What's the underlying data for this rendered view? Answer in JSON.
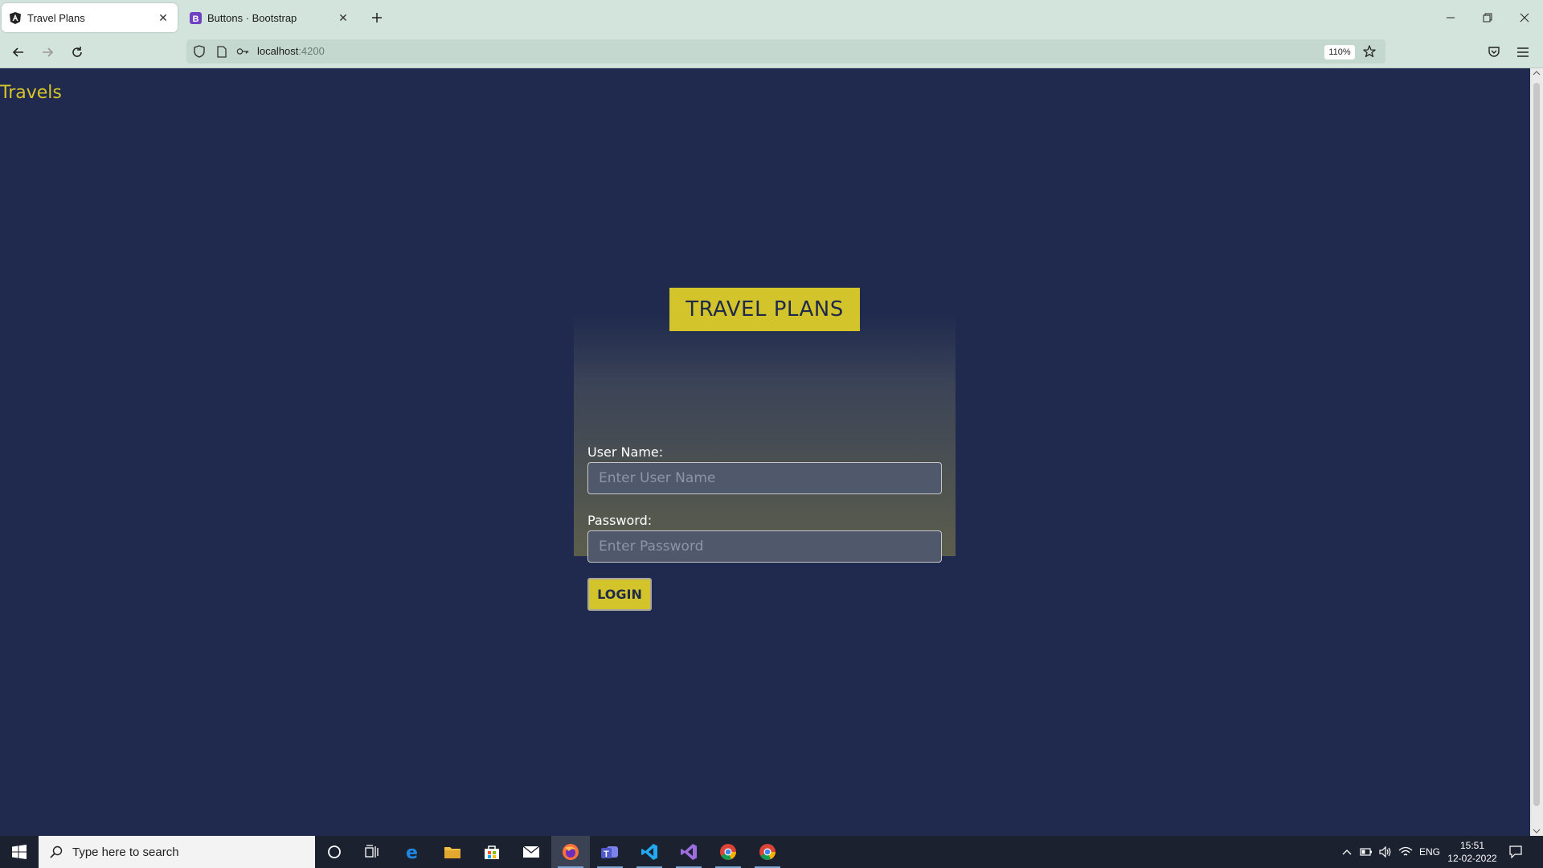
{
  "browser": {
    "tabs": [
      {
        "title": "Travel Plans",
        "favicon": "angular-icon",
        "active": true
      },
      {
        "title": "Buttons · Bootstrap",
        "favicon": "bootstrap-icon",
        "active": false
      }
    ],
    "url": {
      "host": "localhost",
      "port": ":4200"
    },
    "zoom": "110%"
  },
  "page": {
    "brand": "Travels",
    "title_badge": "TRAVEL PLANS",
    "username": {
      "label": "User Name:",
      "placeholder": "Enter User Name",
      "value": ""
    },
    "password": {
      "label": "Password:",
      "placeholder": "Enter Password",
      "value": ""
    },
    "login_button": "LOGIN"
  },
  "taskbar": {
    "search_placeholder": "Type here to search",
    "pinned": [
      "cortana-icon",
      "task-view-icon",
      "edge-icon",
      "file-explorer-icon",
      "store-icon",
      "mail-icon",
      "firefox-icon",
      "teams-icon",
      "vscode-icon",
      "visual-studio-icon",
      "chrome-icon",
      "chrome-icon"
    ],
    "language": "ENG",
    "time": "15:51",
    "date": "12-02-2022"
  },
  "colors": {
    "page_background": "#1f2a4e",
    "accent_yellow": "#d4c42c",
    "chrome_background": "#d3e4dd"
  }
}
